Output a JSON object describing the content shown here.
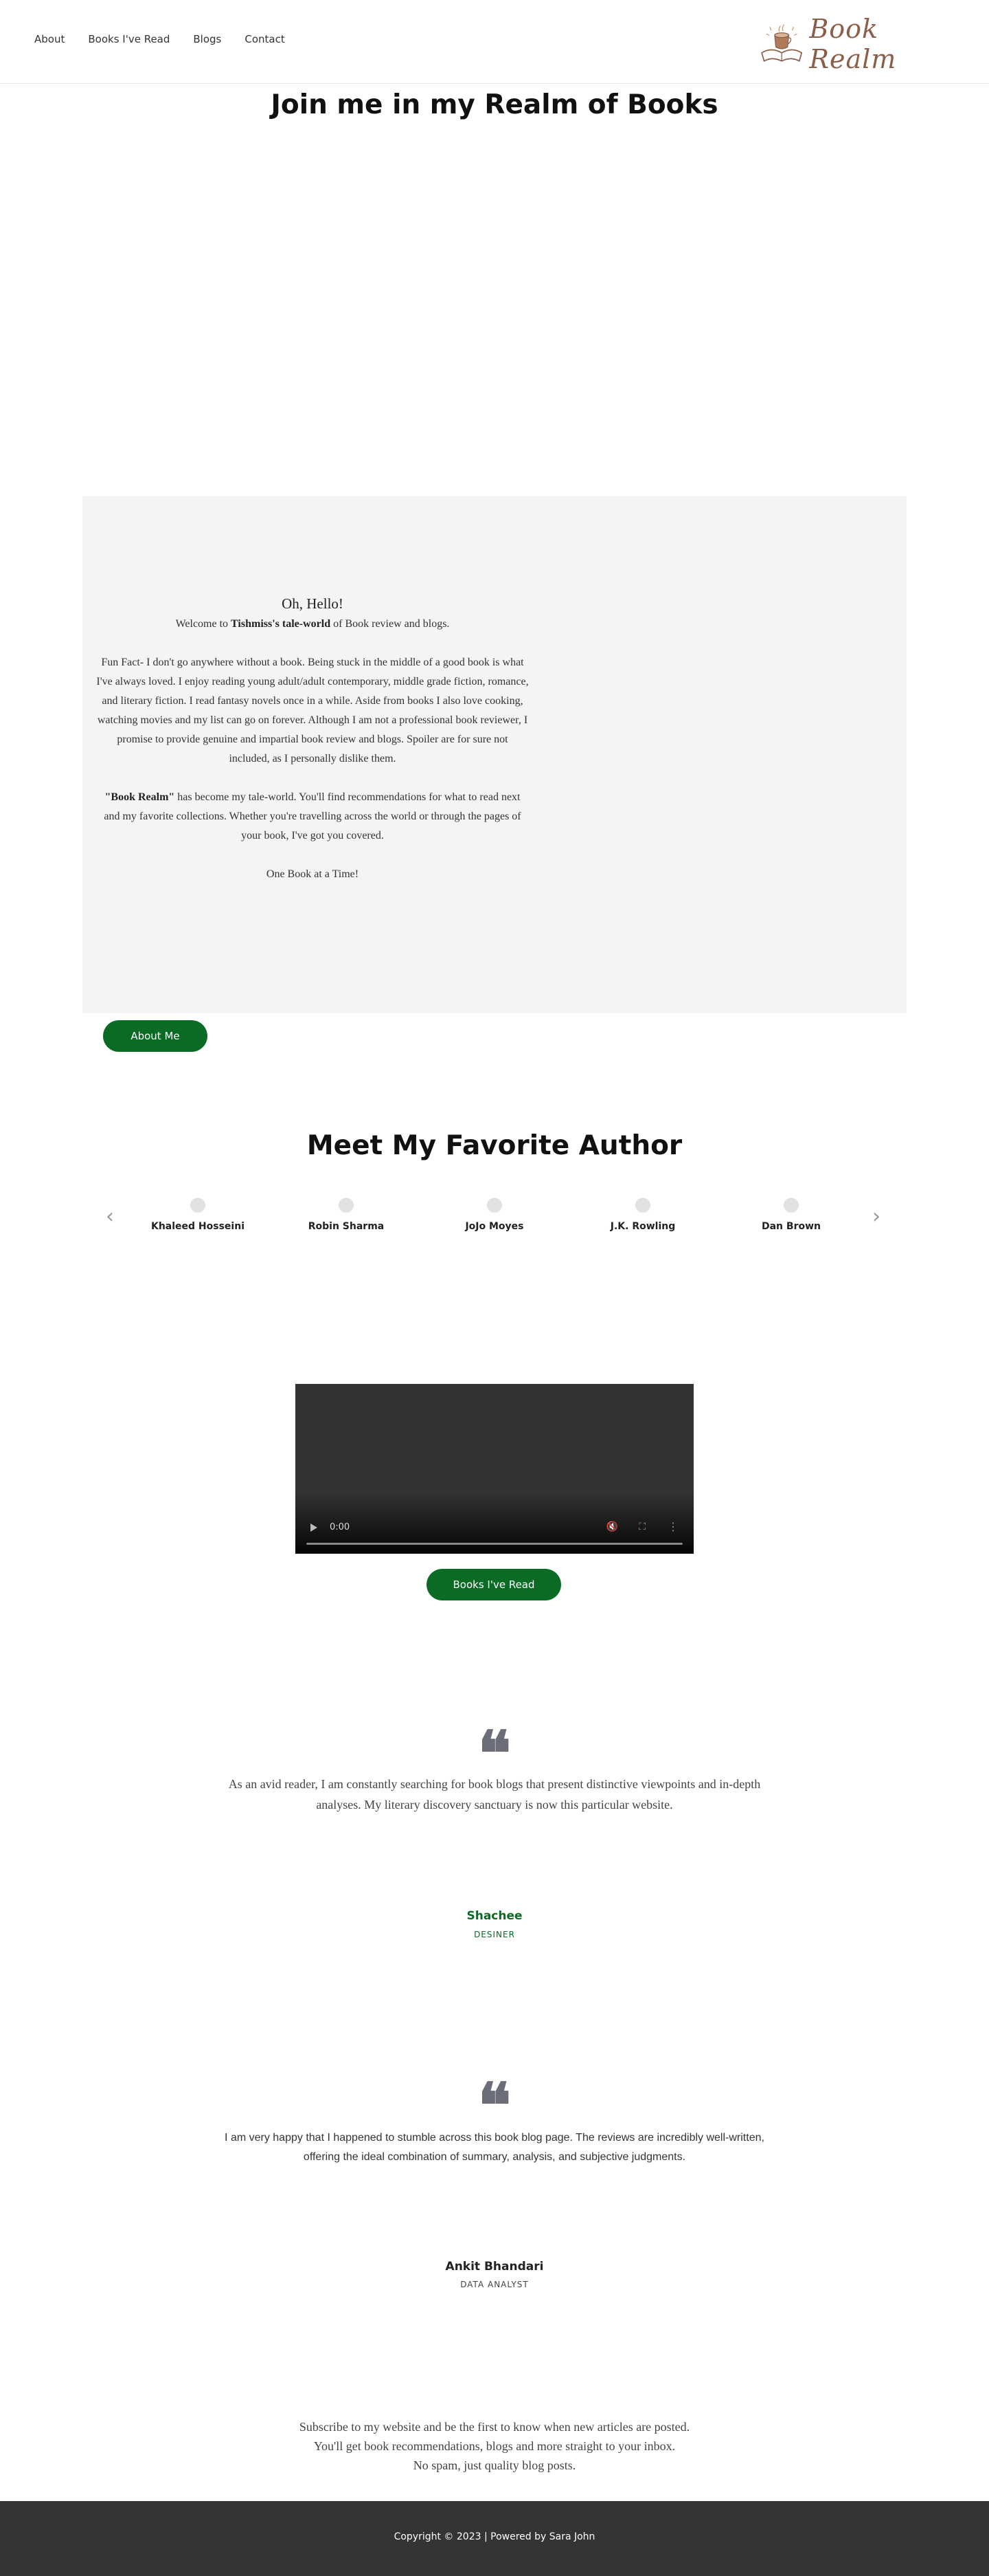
{
  "header": {
    "nav": [
      "About",
      "Books I've Read",
      "Blogs",
      "Contact"
    ],
    "logo_text": "Book Realm"
  },
  "hero": {
    "title": "Join me in my Realm of Books"
  },
  "about": {
    "hello": "Oh, Hello!",
    "welcome_pre": "Welcome to ",
    "welcome_bold": "Tishmiss's tale-world",
    "welcome_post": " of Book review and blogs.",
    "fun_fact": "Fun Fact- I don't go anywhere without a book. Being stuck in the middle of a good book is what I've always loved. I enjoy reading young adult/adult contemporary, middle grade fiction, romance, and literary fiction. I read fantasy novels once in a while. Aside from books I also love cooking, watching movies and my list can go on forever. Although I am not a professional book reviewer, I promise to provide genuine and impartial book review and blogs. Spoiler are for sure not included, as I personally dislike them.",
    "realm_bold": "\"Book Realm\"",
    "realm_text": " has become my tale-world. You'll find recommendations for what to read next and my favorite collections. Whether you're travelling across the world or through the pages of your book, I've got you covered.",
    "tagline": "One Book at a Time!",
    "button": "About Me"
  },
  "authors": {
    "title": "Meet My Favorite Author",
    "prev_icon": "‹",
    "next_icon": "›",
    "items": [
      "Khaleed Hosseini",
      "Robin Sharma",
      "JoJo Moyes",
      "J.K. Rowling",
      "Dan Brown"
    ]
  },
  "video": {
    "time": "0:00",
    "button": "Books I've Read"
  },
  "testimonials": [
    {
      "quote_icon": "❝",
      "text": "As an avid reader, I am constantly searching for book blogs that present distinctive viewpoints and in-depth analyses. My literary discovery sanctuary is now this particular website.",
      "name": "Shachee",
      "role": "DESINER"
    },
    {
      "quote_icon": "❝",
      "text": "I am very happy that I happened to stumble across this book blog page. The reviews are incredibly well-written, offering the ideal combination of summary, analysis, and subjective judgments.",
      "name": "Ankit Bhandari",
      "role": "DATA ANALYST"
    }
  ],
  "subscribe": {
    "line1": "Subscribe to my website and be the first to know when new articles are posted.",
    "line2": "You'll get book recommendations, blogs and more straight to your inbox.",
    "line3": "No spam, just quality blog posts."
  },
  "footer": {
    "text": "Copyright © 2023 | Powered by Sara John"
  },
  "colors": {
    "accent": "#0a6b25",
    "footer_bg": "#343434",
    "about_bg": "#f4f4f4",
    "logo": "#8b5e4a"
  }
}
